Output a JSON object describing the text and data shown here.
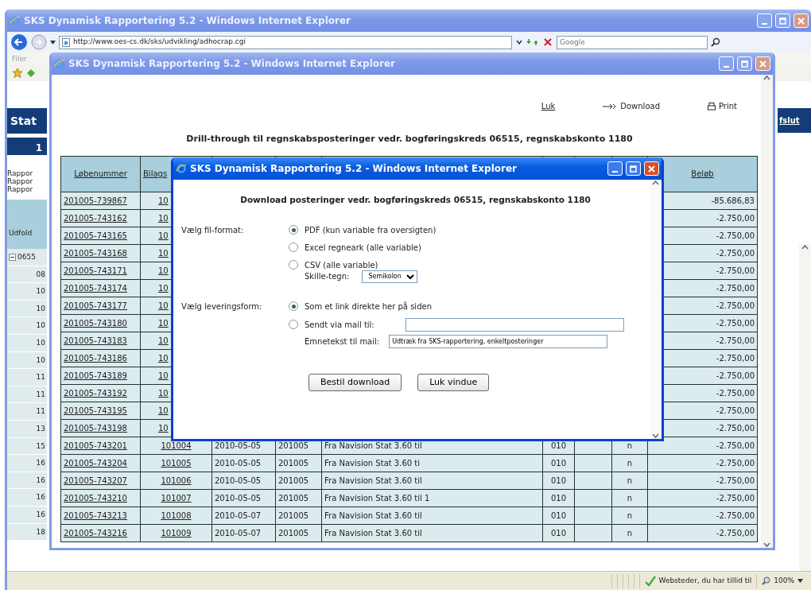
{
  "browser_window": {
    "title": "SKS Dynamisk Rapportering 5.2 - Windows Internet Explorer",
    "active": false,
    "address": "http://www.oes-cs.dk/sks/udvikling/adhocrap.cgi",
    "search": {
      "placeholder": "Google"
    },
    "menu": [
      "Filer"
    ],
    "page": {
      "heading": "Stat",
      "tab": "1",
      "report_lines": [
        "Rappor",
        "Rappor",
        "Rappor"
      ],
      "column_header": "Udfold",
      "tree_root": {
        "label": "0655",
        "expanded": true
      },
      "row_labels": [
        "08",
        "10",
        "10",
        "10",
        "10",
        "10",
        "11",
        "11",
        "11",
        "13",
        "15",
        "16",
        "16",
        "16",
        "16",
        "18"
      ],
      "right_link": "fslut"
    },
    "status_bar": {
      "zone": "Websteder, du har tillid til",
      "zoom": "100%"
    }
  },
  "report_window": {
    "title": "SKS Dynamisk Rapportering 5.2 - Windows Internet Explorer",
    "active": false,
    "links": [
      {
        "kind": "link",
        "label": "Luk"
      },
      {
        "kind": "download",
        "label": "Download"
      },
      {
        "kind": "print",
        "label": "Print"
      }
    ],
    "heading": "Drill-through til regnskabsposteringer vedr. bogføringskreds 06515, regnskabskonto 1180",
    "table": {
      "columns": {
        "column_1": "Løbenummer",
        "column_2": "Bilags",
        "column_9": "Beløb"
      },
      "rows": [
        {
          "column_1": "201005-739867",
          "column_2": "10",
          "column_9": "-85.686,83"
        },
        {
          "column_1": "201005-743162",
          "column_2": "10",
          "column_9": "-2.750,00"
        },
        {
          "column_1": "201005-743165",
          "column_2": "10",
          "column_9": "-2.750,00"
        },
        {
          "column_1": "201005-743168",
          "column_2": "10",
          "column_9": "-2.750,00"
        },
        {
          "column_1": "201005-743171",
          "column_2": "10",
          "column_9": "-2.750,00"
        },
        {
          "column_1": "201005-743174",
          "column_2": "10",
          "column_9": "-2.750,00"
        },
        {
          "column_1": "201005-743177",
          "column_2": "10",
          "column_9": "-2.750,00"
        },
        {
          "column_1": "201005-743180",
          "column_2": "10",
          "column_9": "-2.750,00"
        },
        {
          "column_1": "201005-743183",
          "column_2": "10",
          "column_9": "-2.750,00"
        },
        {
          "column_1": "201005-743186",
          "column_2": "10",
          "column_9": "-2.750,00"
        },
        {
          "column_1": "201005-743189",
          "column_2": "10",
          "column_9": "-2.750,00"
        },
        {
          "column_1": "201005-743192",
          "column_2": "10",
          "column_9": "-2.750,00"
        },
        {
          "column_1": "201005-743195",
          "column_2": "10",
          "column_9": "-2.750,00"
        },
        {
          "column_1": "201005-743198",
          "column_2": "10",
          "column_9": "-2.750,00"
        },
        {
          "column_1": "201005-743201",
          "column_2": "101004",
          "column_3": "2010-05-05",
          "column_4": "201005",
          "column_5": "Fra Navision Stat 3.60 til",
          "column_6": "010",
          "column_8": "n",
          "column_9": "-2.750,00"
        },
        {
          "column_1": "201005-743204",
          "column_2": "101005",
          "column_3": "2010-05-05",
          "column_4": "201005",
          "column_5": "Fra Navision Stat 3.60 ti",
          "column_6": "010",
          "column_8": "n",
          "column_9": "-2.750,00"
        },
        {
          "column_1": "201005-743207",
          "column_2": "101006",
          "column_3": "2010-05-05",
          "column_4": "201005",
          "column_5": "Fra Navision Stat 3.60 til",
          "column_6": "010",
          "column_8": "n",
          "column_9": "-2.750,00"
        },
        {
          "column_1": "201005-743210",
          "column_2": "101007",
          "column_3": "2010-05-05",
          "column_4": "201005",
          "column_5": "Fra Navision Stat 3.60 til 1",
          "column_6": "010",
          "column_8": "n",
          "column_9": "-2.750,00"
        },
        {
          "column_1": "201005-743213",
          "column_2": "101008",
          "column_3": "2010-05-07",
          "column_4": "201005",
          "column_5": "Fra Navision Stat 3.60 til",
          "column_6": "010",
          "column_8": "n",
          "column_9": "-2.750,00"
        },
        {
          "column_1": "201005-743216",
          "column_2": "101009",
          "column_3": "2010-05-07",
          "column_4": "201005",
          "column_5": "Fra Navision Stat 3.60 til",
          "column_6": "010",
          "column_8": "n",
          "column_9": "-2.750,00"
        }
      ]
    }
  },
  "dialog": {
    "title": "SKS Dynamisk Rapportering 5.2 - Windows Internet Explorer",
    "active": true,
    "heading": "Download posteringer vedr. bogføringskreds 06515, regnskabskonto 1180",
    "file_format": {
      "label": "Vælg fil-format:",
      "options": [
        {
          "label": "PDF (kun variable fra oversigten)",
          "selected": true
        },
        {
          "label": "Excel regneark (alle variable)",
          "selected": false
        },
        {
          "label": "CSV (alle variable)",
          "selected": false
        }
      ],
      "separator": {
        "label": "Skille-tegn:",
        "value": "Semikolon"
      }
    },
    "delivery": {
      "label": "Vælg leveringsform:",
      "options": [
        {
          "label": "Som et link direkte her på siden",
          "selected": true
        },
        {
          "label": "Sendt via mail til:",
          "selected": false
        }
      ],
      "subject": {
        "label": "Emnetekst til mail:",
        "value": "Udtræk fra SKS-rapportering, enkeltposteringer"
      }
    },
    "buttons": [
      "Bestil download",
      "Luk vindue"
    ]
  }
}
